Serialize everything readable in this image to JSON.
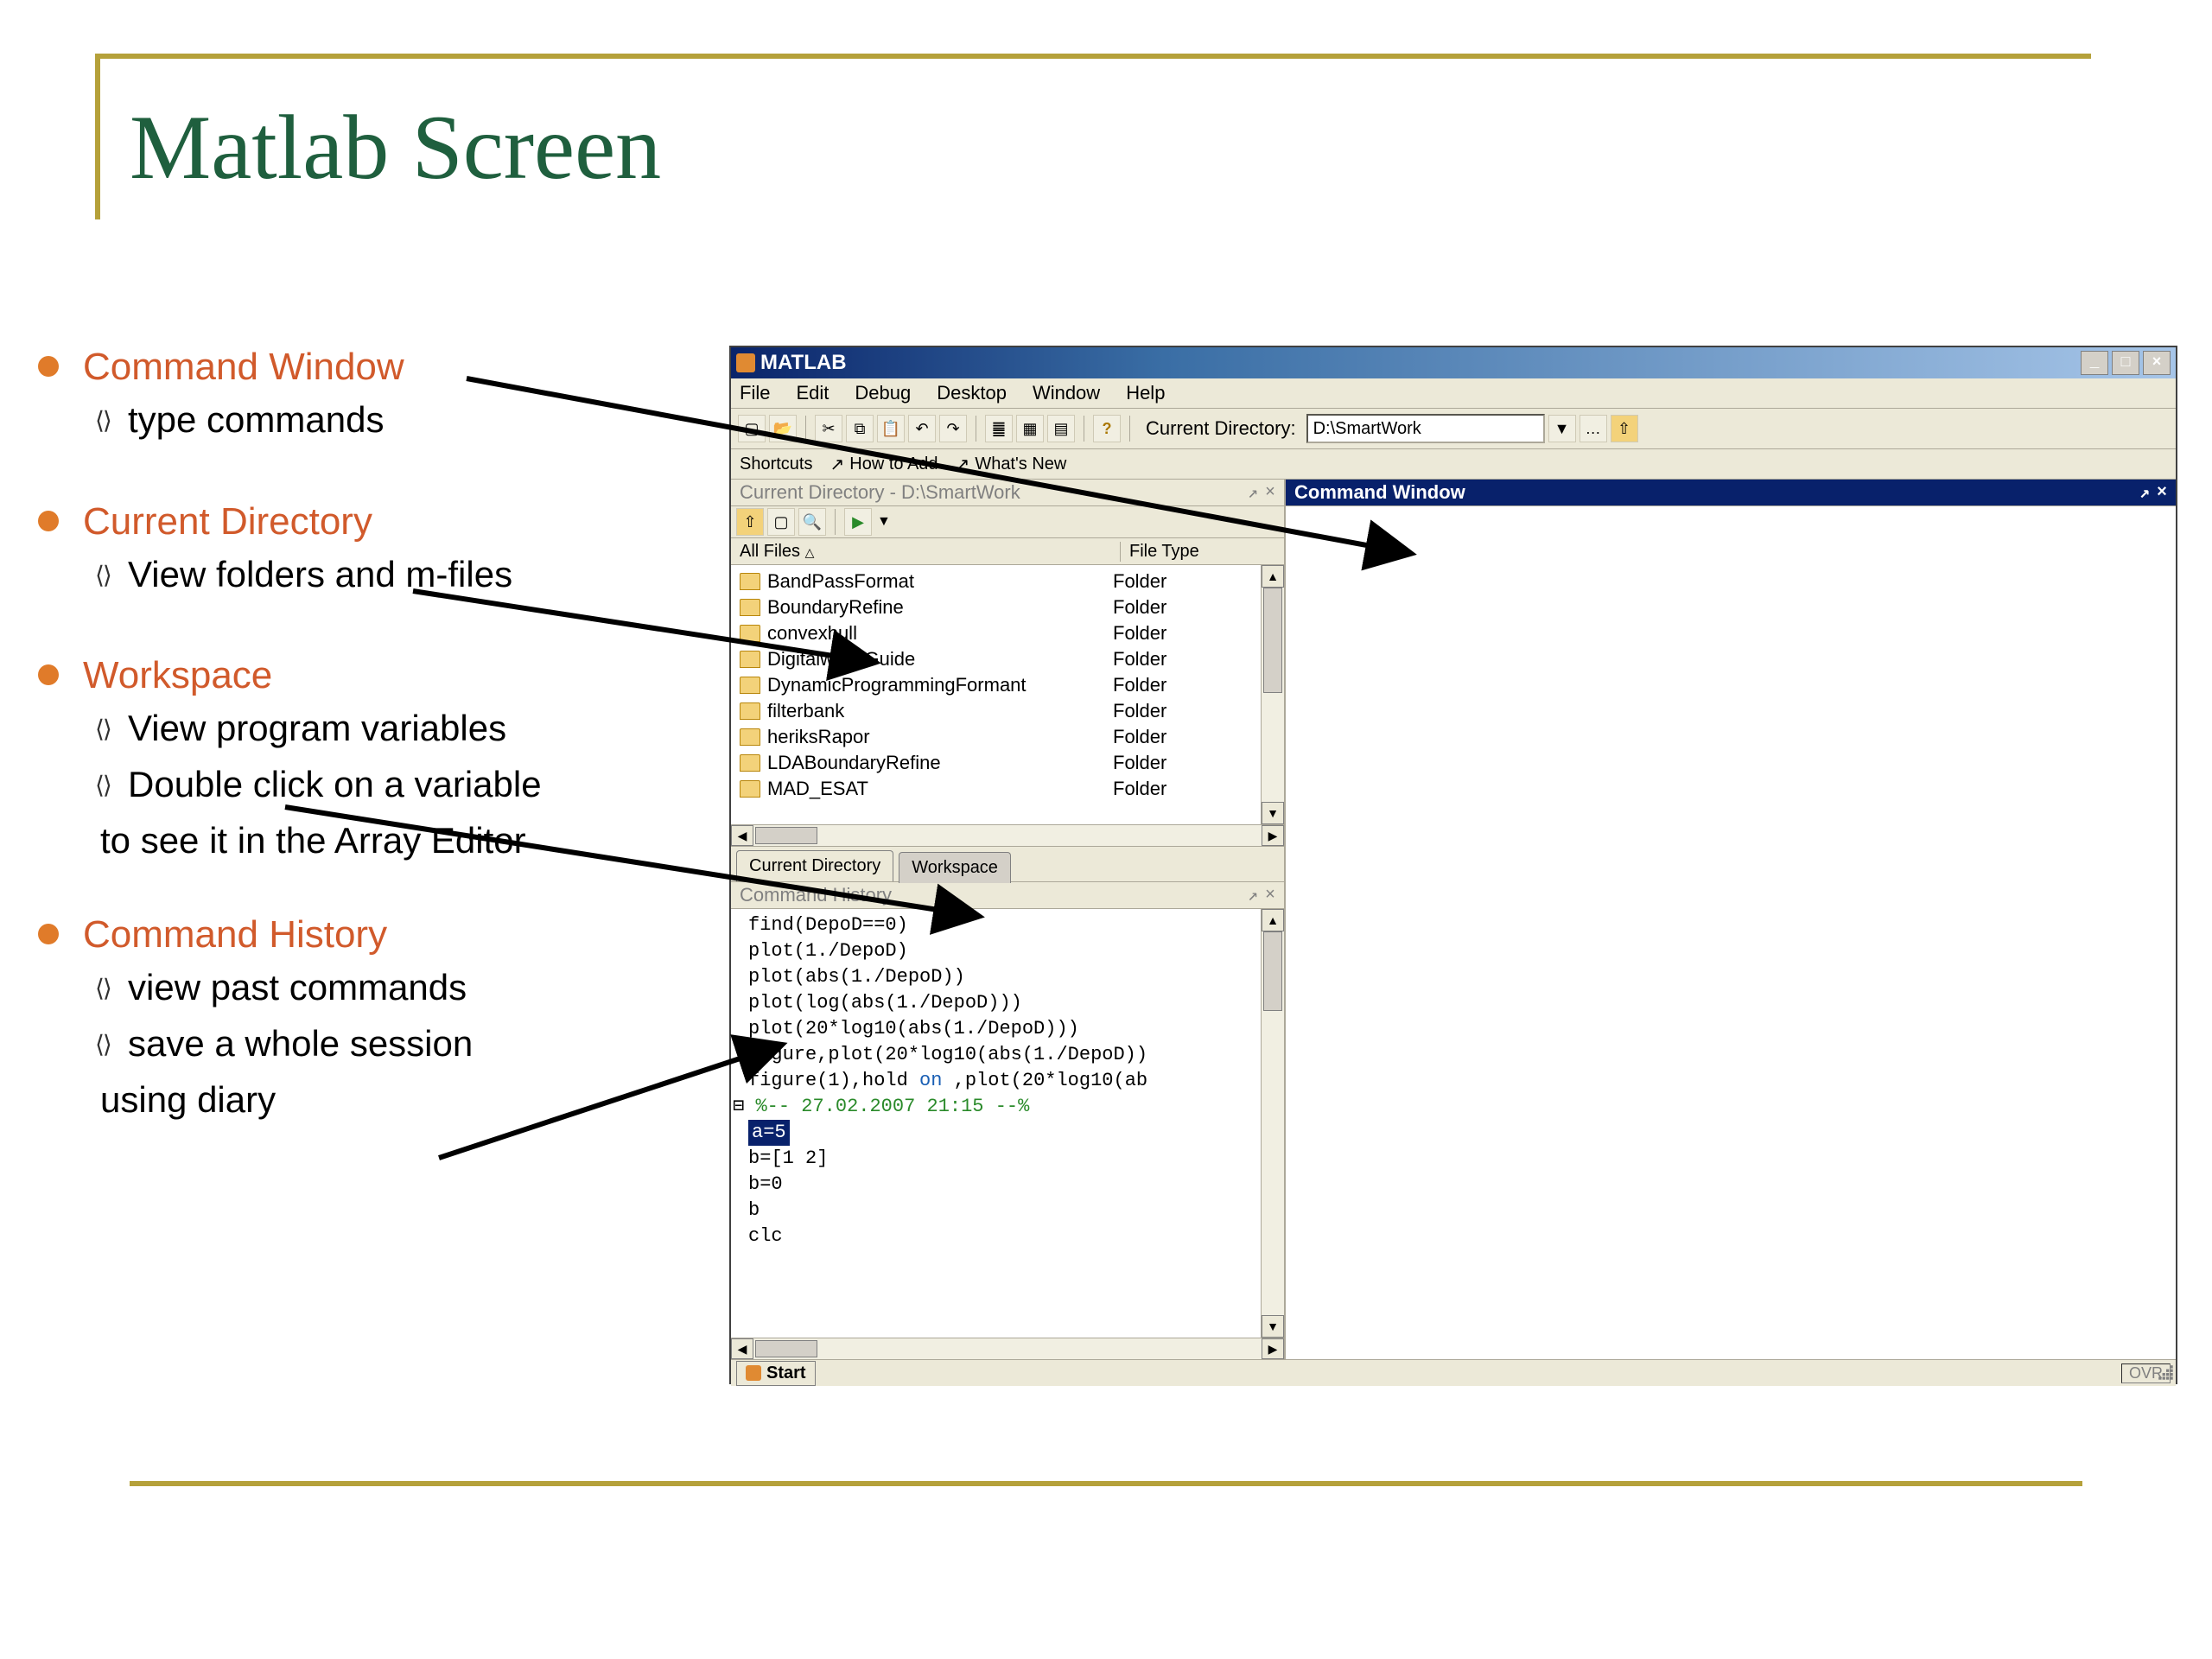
{
  "slide": {
    "title": "Matlab Screen"
  },
  "outline": {
    "items": [
      {
        "heading": "Command Window",
        "subs": [
          "type commands"
        ]
      },
      {
        "heading": "Current Directory",
        "subs": [
          "View folders and m-files"
        ]
      },
      {
        "heading": "Workspace",
        "subs": [
          "View program variables",
          "Double click on a variable"
        ],
        "cont": "to see it in the Array Editor"
      },
      {
        "heading": "Command History",
        "subs": [
          "view past commands",
          "save a whole session"
        ],
        "cont": "using diary"
      }
    ]
  },
  "matlab": {
    "title": "MATLAB",
    "winbtns": {
      "min": "_",
      "max": "□",
      "close": "×"
    },
    "menus": [
      "File",
      "Edit",
      "Debug",
      "Desktop",
      "Window",
      "Help"
    ],
    "toolbar": {
      "curdir_label": "Current Directory:",
      "curdir_value": "D:\\SmartWork"
    },
    "shortcuts": {
      "label": "Shortcuts",
      "how": "How to Add",
      "whatsnew": "What's New"
    },
    "curdir_panel": {
      "title": "Current Directory - D:\\SmartWork",
      "cols": {
        "files": "All Files",
        "type": "File Type"
      },
      "rows": [
        {
          "name": "BandPassFormat",
          "type": "Folder"
        },
        {
          "name": "BoundaryRefine",
          "type": "Folder"
        },
        {
          "name": "convexhull",
          "type": "Folder"
        },
        {
          "name": "DigitalwaveGuide",
          "type": "Folder"
        },
        {
          "name": "DynamicProgrammingFormant",
          "type": "Folder"
        },
        {
          "name": "filterbank",
          "type": "Folder"
        },
        {
          "name": "heriksRapor",
          "type": "Folder"
        },
        {
          "name": "LDABoundaryRefine",
          "type": "Folder"
        },
        {
          "name": "MAD_ESAT",
          "type": "Folder"
        }
      ],
      "clipped": {
        "name": "…",
        "type": "Folder"
      }
    },
    "tabs": {
      "t1": "Current Directory",
      "t2": "Workspace"
    },
    "history": {
      "title": "Command History",
      "lines": [
        "find(DepoD==0)",
        "plot(1./DepoD)",
        "plot(abs(1./DepoD))",
        "plot(log(abs(1./DepoD)))",
        "plot(20*log10(abs(1./DepoD)))",
        "figure,plot(20*log10(abs(1./DepoD))"
      ],
      "line_on_prefix": "figure(1),hold ",
      "line_on_kw": "on",
      "line_on_suffix": " ,plot(20*log10(ab",
      "date": "%-- 27.02.2007 21:15 --%",
      "sel": "a=5",
      "rest": [
        "b=[1 2]",
        "b=0",
        "b",
        "clc"
      ]
    },
    "cmdwin": {
      "title": "Command Window"
    },
    "start": "Start",
    "ovr": "OVR"
  }
}
